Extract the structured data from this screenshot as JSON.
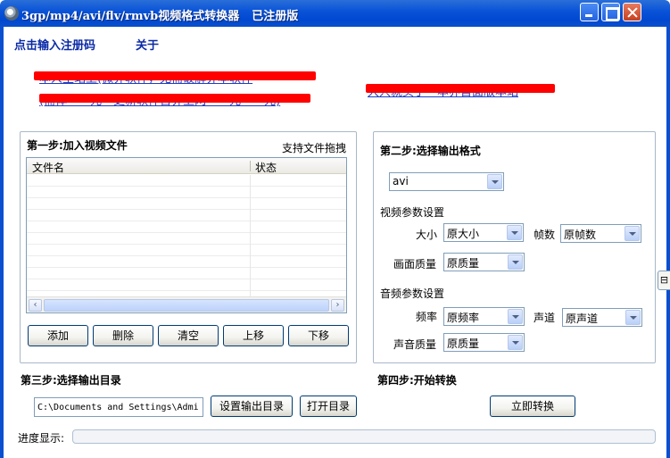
{
  "window": {
    "title": "3gp/mp4/avi/flv/rmvb视频格式转换器",
    "registration_status": "已注册版"
  },
  "menu": {
    "register": "点击输入注册码",
    "about": "关于"
  },
  "promo_links": {
    "line1": "本人主站上(微界软件，无需破解界本软件",
    "line2": "(需体一一元一更新软件首界上网一一元一一元)",
    "line3": "大兴就买了一本界首面版本站"
  },
  "colors": {
    "titlebar": "#0a54d8",
    "redaction": "#ff0000",
    "link": "#1f3fbf",
    "progress": "#2cb33a"
  },
  "step1": {
    "title": "第一步:加入视频文件",
    "drag_hint": "支持文件拖拽",
    "columns": [
      "文件名",
      "状态"
    ],
    "rows": [],
    "buttons": {
      "add": "添加",
      "delete": "删除",
      "clear": "清空",
      "up": "上移",
      "down": "下移"
    }
  },
  "step2": {
    "title": "第二步:选择输出格式",
    "format": "avi",
    "video_section": "视频参数设置",
    "size_label": "大小",
    "size_value": "原大小",
    "fps_label": "帧数",
    "fps_value": "原帧数",
    "quality_label": "画面质量",
    "quality_value": "原质量",
    "audio_section": "音频参数设置",
    "freq_label": "频率",
    "freq_value": "原频率",
    "channel_label": "声道",
    "channel_value": "原声道",
    "audio_quality_label": "声音质量",
    "audio_quality_value": "原质量"
  },
  "step3": {
    "title": "第三步:选择输出目录",
    "output_path": "C:\\Documents and Settings\\Admir",
    "set_dir_button": "设置输出目录",
    "open_dir_button": "打开目录"
  },
  "step4": {
    "title": "第四步:开始转换",
    "convert_button": "立即转换"
  },
  "progress": {
    "label": "进度显示:",
    "value": 0
  },
  "icons": {
    "app": "film-reel-icon",
    "minimize": "minimize-icon",
    "maximize": "maximize-icon",
    "close": "close-icon",
    "combo_arrow": "chevron-down-icon",
    "scroll_left": "arrow-left-icon",
    "scroll_right": "arrow-right-icon"
  }
}
